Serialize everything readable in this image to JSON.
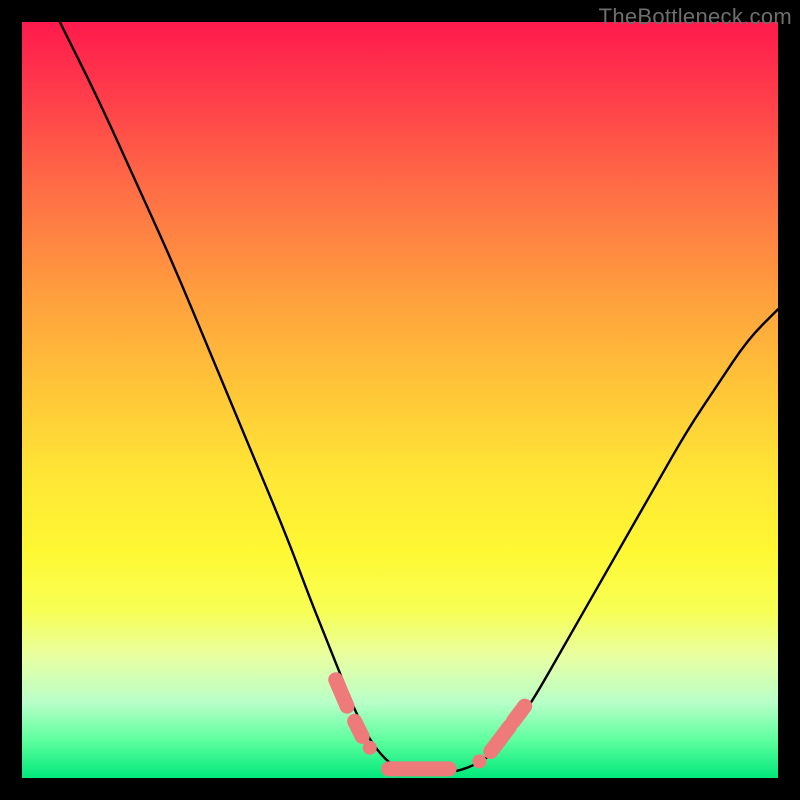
{
  "watermark": "TheBottleneck.com",
  "chart_data": {
    "type": "line",
    "title": "",
    "xlabel": "",
    "ylabel": "",
    "xlim": [
      0,
      100
    ],
    "ylim": [
      0,
      100
    ],
    "grid": false,
    "legend": false,
    "series": [
      {
        "name": "bottleneck-curve",
        "x": [
          0,
          5,
          10,
          15,
          20,
          25,
          30,
          35,
          38,
          40,
          42,
          44,
          46,
          48,
          50,
          52,
          54,
          56,
          58,
          60,
          62,
          64,
          66,
          68,
          72,
          76,
          80,
          84,
          88,
          92,
          96,
          100
        ],
        "y": [
          null,
          100,
          90,
          79,
          68,
          56,
          44,
          32,
          24,
          19,
          14,
          9,
          5,
          2.5,
          1,
          0.5,
          0.5,
          0.7,
          1,
          1.8,
          3,
          5,
          8,
          11,
          18,
          25,
          32,
          39,
          46,
          52,
          58,
          62
        ]
      }
    ],
    "markers": [
      {
        "name": "segment-left-1",
        "x0": 41.5,
        "y0": 13.0,
        "x1": 43.0,
        "y1": 9.5
      },
      {
        "name": "segment-left-2",
        "x0": 44.0,
        "y0": 7.5,
        "x1": 45.0,
        "y1": 5.5
      },
      {
        "name": "dot-left",
        "x0": 46.0,
        "y0": 4.0,
        "x1": 46.0,
        "y1": 4.0
      },
      {
        "name": "segment-bottom",
        "x0": 48.5,
        "y0": 1.2,
        "x1": 56.5,
        "y1": 1.2
      },
      {
        "name": "dot-right",
        "x0": 60.5,
        "y0": 2.2,
        "x1": 60.5,
        "y1": 2.2
      },
      {
        "name": "segment-right-1",
        "x0": 62.0,
        "y0": 3.5,
        "x1": 64.5,
        "y1": 6.8
      },
      {
        "name": "segment-right-2",
        "x0": 65.0,
        "y0": 7.5,
        "x1": 66.5,
        "y1": 9.5
      }
    ],
    "marker_color": "#ef7a7a",
    "curve_color": "#000000"
  }
}
